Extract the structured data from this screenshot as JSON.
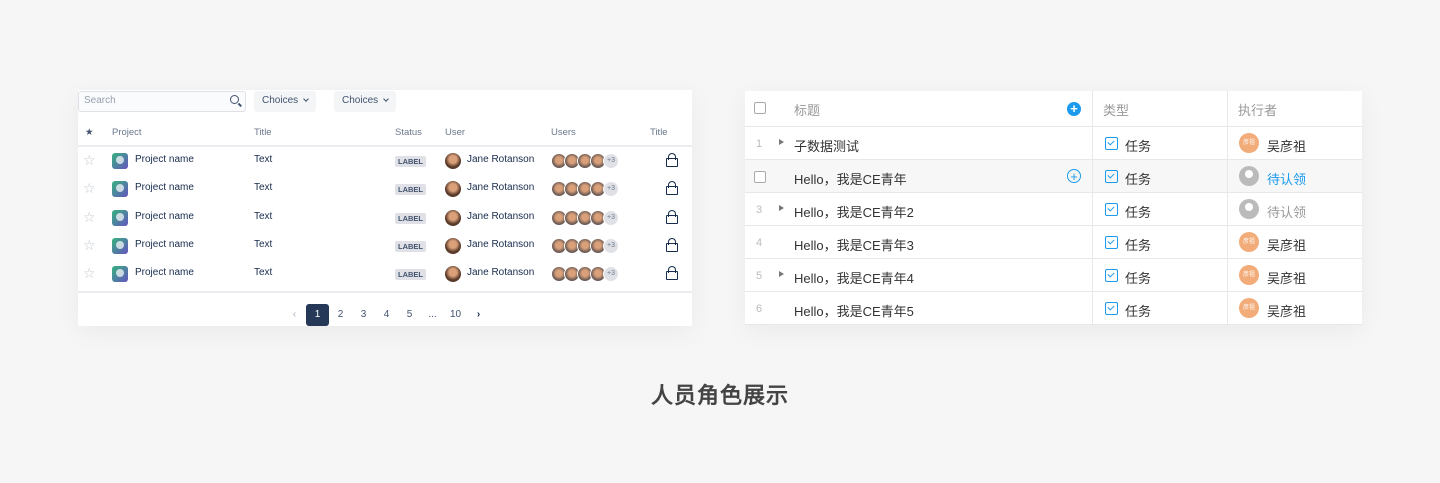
{
  "left_table": {
    "search_placeholder": "Search",
    "filters": [
      "Choices",
      "Choices"
    ],
    "headers": {
      "star": "★",
      "project": "Project",
      "title": "Title",
      "status": "Status",
      "user": "User",
      "users": "Users",
      "title2": "Title"
    },
    "rows": [
      {
        "project": "Project name",
        "title": "Text",
        "status": "LABEL",
        "user": "Jane Rotanson",
        "more": "+3"
      },
      {
        "project": "Project name",
        "title": "Text",
        "status": "LABEL",
        "user": "Jane Rotanson",
        "more": "+3"
      },
      {
        "project": "Project name",
        "title": "Text",
        "status": "LABEL",
        "user": "Jane Rotanson",
        "more": "+3"
      },
      {
        "project": "Project name",
        "title": "Text",
        "status": "LABEL",
        "user": "Jane Rotanson",
        "more": "+3"
      },
      {
        "project": "Project name",
        "title": "Text",
        "status": "LABEL",
        "user": "Jane Rotanson",
        "more": "+3"
      }
    ],
    "pagination": {
      "pages": [
        "1",
        "2",
        "3",
        "4",
        "5",
        "...",
        "10"
      ],
      "current": "1"
    }
  },
  "right_table": {
    "headers": {
      "title": "标题",
      "type": "类型",
      "assignee": "执行者"
    },
    "rows": [
      {
        "num": "1",
        "title": "子数据测试",
        "type": "任务",
        "assignee": "吴彦祖",
        "avatar": "彦祖"
      },
      {
        "num": "",
        "title": "Hello，我是CE青年",
        "type": "任务",
        "assignee": "待认领",
        "avatar": ""
      },
      {
        "num": "3",
        "title": "Hello，我是CE青年2",
        "type": "任务",
        "assignee": "待认领",
        "avatar": ""
      },
      {
        "num": "4",
        "title": "Hello，我是CE青年3",
        "type": "任务",
        "assignee": "吴彦祖",
        "avatar": "彦祖"
      },
      {
        "num": "5",
        "title": "Hello，我是CE青年4",
        "type": "任务",
        "assignee": "吴彦祖",
        "avatar": "彦祖"
      },
      {
        "num": "6",
        "title": "Hello，我是CE青年5",
        "type": "任务",
        "assignee": "吴彦祖",
        "avatar": "彦祖"
      }
    ]
  },
  "caption": "人员角色展示",
  "colors": {
    "accent": "#1b9aee",
    "pager_active": "#253858",
    "avatar_orange": "#f2ac79"
  }
}
